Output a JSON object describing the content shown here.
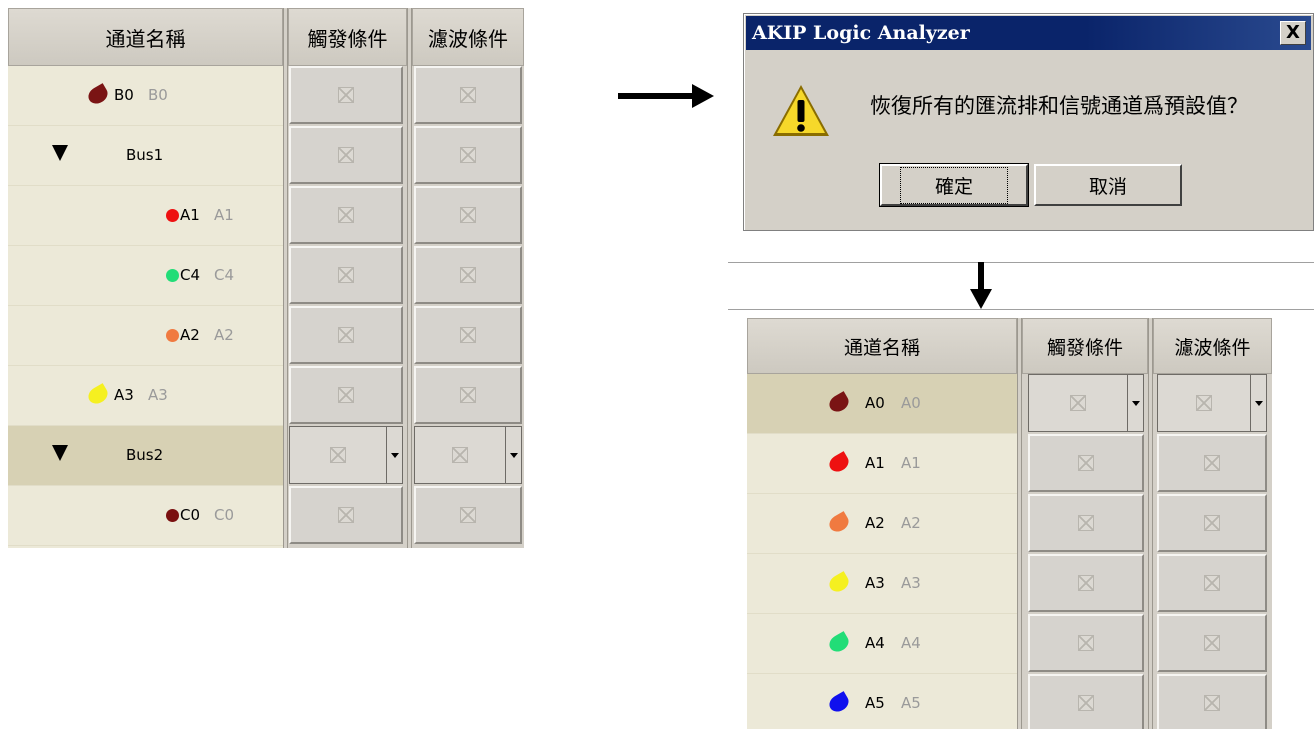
{
  "headers": {
    "name": "通道名稱",
    "trigger": "觸發條件",
    "filter": "濾波條件"
  },
  "left_panel": {
    "rows": [
      {
        "kind": "signal",
        "label": "B0",
        "alias": "B0",
        "icon": "drop-icon",
        "color": "#7a1414",
        "indent": "medium"
      },
      {
        "kind": "bus",
        "label": "Bus1",
        "icon": "expander-icon"
      },
      {
        "kind": "signal",
        "label": "A1",
        "alias": "A1",
        "icon": "dot-icon",
        "color": "#ee1111",
        "indent": "deep"
      },
      {
        "kind": "signal",
        "label": "C4",
        "alias": "C4",
        "icon": "dot-icon",
        "color": "#22dd77",
        "indent": "deep"
      },
      {
        "kind": "signal",
        "label": "A2",
        "alias": "A2",
        "icon": "dot-icon",
        "color": "#f07a40",
        "indent": "deep"
      },
      {
        "kind": "signal",
        "label": "A3",
        "alias": "A3",
        "icon": "drop-icon",
        "color": "#f5f020",
        "indent": "shallow"
      },
      {
        "kind": "bus",
        "label": "Bus2",
        "icon": "expander-icon",
        "selected": true
      },
      {
        "kind": "signal",
        "label": "C0",
        "alias": "C0",
        "icon": "dot-icon",
        "color": "#7a1010",
        "indent": "deep"
      }
    ]
  },
  "dialog": {
    "title": "AKIP Logic Analyzer",
    "close_label": "X",
    "icon": "warning-icon",
    "message": "恢復所有的匯流排和信號通道爲預設值？",
    "ok_label": "確定",
    "cancel_label": "取消"
  },
  "right_panel": {
    "rows": [
      {
        "label": "A0",
        "alias": "A0",
        "color": "#7a1414",
        "selected": true
      },
      {
        "label": "A1",
        "alias": "A1",
        "color": "#ee1111"
      },
      {
        "label": "A2",
        "alias": "A2",
        "color": "#f07a40"
      },
      {
        "label": "A3",
        "alias": "A3",
        "color": "#f5f020"
      },
      {
        "label": "A4",
        "alias": "A4",
        "color": "#22dd77"
      },
      {
        "label": "A5",
        "alias": "A5",
        "color": "#1010ee"
      }
    ]
  }
}
